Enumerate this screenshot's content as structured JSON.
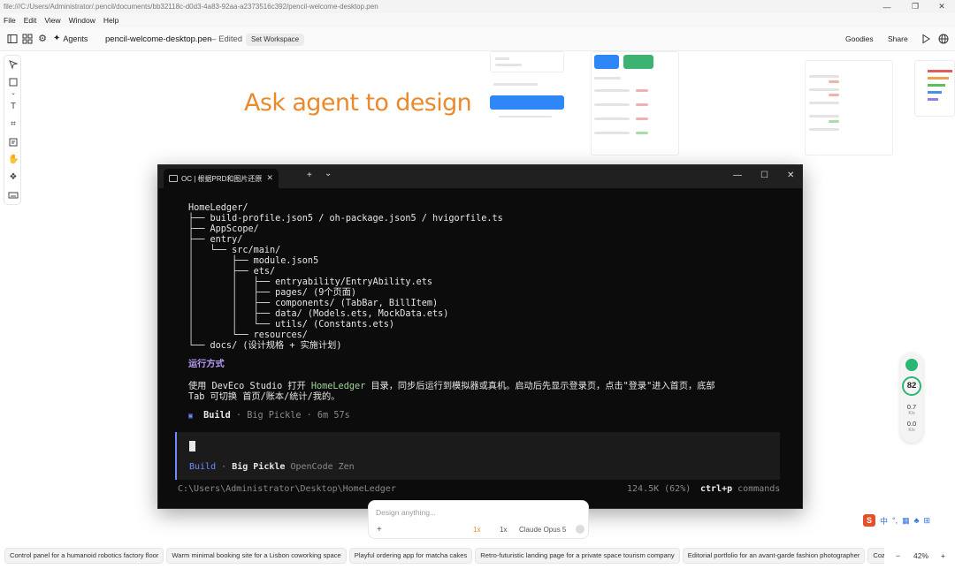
{
  "window": {
    "path": "file:///C:/Users/Administrator/.pencil/documents/bb32118c-d0d3-4a83-92aa-a2373516c392/pencil-welcome-desktop.pen",
    "min_glyph": "—",
    "max_glyph": "❐",
    "close_glyph": "✕"
  },
  "menu": [
    "File",
    "Edit",
    "View",
    "Window",
    "Help"
  ],
  "toolbar": {
    "agents_label": "Agents",
    "doc_name": "pencil-welcome-desktop.pen",
    "edited": "— Edited",
    "set_workspace": "Set Workspace",
    "goodies": "Goodies",
    "share": "Share"
  },
  "canvas": {
    "headline": "Ask agent to design",
    "accent_color": "#e98a2c"
  },
  "terminal": {
    "tab_title": "OC | 根据PRD和图片还原Home",
    "new_tab": "+",
    "dropdown": "⌄",
    "lines": [
      "HomeLedger/",
      "├── build-profile.json5 / oh-package.json5 / hvigorfile.ts",
      "├── AppScope/",
      "├── entry/",
      "│   └── src/main/",
      "│       ├── module.json5",
      "│       ├── ets/",
      "│       │   ├── entryability/EntryAbility.ets",
      "│       │   ├── pages/ (9个页面)",
      "│       │   ├── components/ (TabBar, BillItem)",
      "│       │   ├── data/ (Models.ets, MockData.ets)",
      "│       │   └── utils/ (Constants.ets)",
      "│       └── resources/",
      "└── docs/ (设计规格 + 实施计划)"
    ],
    "run_heading": "运行方式",
    "run_text_1a": "使用 DevEco Studio 打开 ",
    "run_text_1b": "HomeLedger",
    "run_text_1c": " 目录，同步后运行到模拟器或真机。启动后先显示登录页，点击\"登录\"进入首页，底部",
    "run_text_2": "Tab 可切换 首页/账本/统计/我的。",
    "build_marker": "▣",
    "build_label": "Build",
    "build_model": "· Big Pickle · 6m 57s",
    "mode_build": "Build",
    "mode_sep": "·",
    "mode_model": "Big Pickle",
    "mode_provider": "OpenCode Zen",
    "cwd": "C:\\Users\\Administrator\\Desktop\\HomeLedger",
    "tokens": "124.5K (62%)",
    "shortcut_key": "ctrl+p",
    "shortcut_label": "commands"
  },
  "prompt": {
    "placeholder": "Design anything...",
    "plus": "+",
    "speed_a": "1x",
    "speed_b": "1x",
    "model": "Claude Opus 5"
  },
  "widget": {
    "score": "82",
    "val1": "0.7",
    "unit1": "K/s",
    "val2": "0.0",
    "unit2": "K/s"
  },
  "ime": [
    "中",
    "°,",
    "▦",
    "♣",
    "⊞"
  ],
  "suggestions": [
    "Control panel for a humanoid robotics factory floor",
    "Warm minimal booking site for a Lisbon coworking space",
    "Playful ordering app for matcha cakes",
    "Retro-futuristic landing page for a private space tourism company",
    "Editorial portfolio for an avant-garde fashion photographer",
    "Cozy"
  ],
  "zoom": {
    "minus": "−",
    "level": "42%",
    "plus": "+"
  }
}
